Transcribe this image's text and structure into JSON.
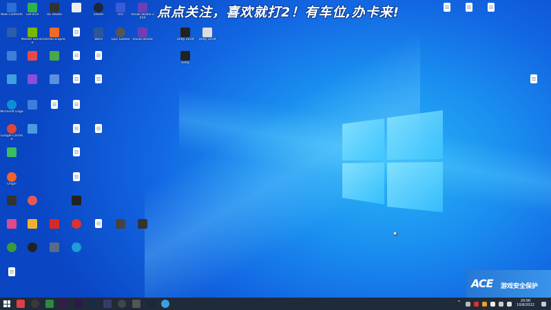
{
  "banner": "点点关注，喜欢就打2！有车位,办卡来!",
  "desktop_icons": [
    {
      "id": "i1",
      "label": "New Contents",
      "color": "#2a6fd1"
    },
    {
      "id": "i2",
      "label": "GeForce",
      "color": "#2eb34a"
    },
    {
      "id": "i3",
      "label": "UE Studio",
      "color": "#333333"
    },
    {
      "id": "i4",
      "label": "",
      "color": "#eeeeee"
    },
    {
      "id": "i5",
      "label": "Steam",
      "color": "#1b2838"
    },
    {
      "id": "i6",
      "label": "Uro",
      "color": "#3a5bd9"
    },
    {
      "id": "i7",
      "label": "Visual Studio 2019",
      "color": "#6c3fb5"
    },
    {
      "id": "i8",
      "label": "",
      "color": "#2b5ea8"
    },
    {
      "id": "i9",
      "label": "NVIDIA GeForce",
      "color": "#76b900"
    },
    {
      "id": "i10",
      "label": "Unreal Engine",
      "color": "#f06a28"
    },
    {
      "id": "i11",
      "label": "",
      "color": "#ffffff"
    },
    {
      "id": "i12",
      "label": "Word",
      "color": "#2b579a"
    },
    {
      "id": "i13",
      "label": "Epic Games",
      "color": "#555555"
    },
    {
      "id": "i14",
      "label": "Visual Studio",
      "color": "#6c3fb5"
    },
    {
      "id": "i15",
      "label": "Unity 2019",
      "color": "#222222"
    },
    {
      "id": "i16",
      "label": "Unity 2019",
      "color": "#dddddd"
    },
    {
      "id": "i17",
      "label": "",
      "color": "#3b80d9"
    },
    {
      "id": "i18",
      "label": "",
      "color": "#e34b4b"
    },
    {
      "id": "i19",
      "label": "",
      "color": "#4aa84a"
    },
    {
      "id": "i20",
      "label": "",
      "color": "#ffffff"
    },
    {
      "id": "i21",
      "label": "",
      "color": "#ffffff"
    },
    {
      "id": "i22",
      "label": "Unity",
      "color": "#222222"
    },
    {
      "id": "i23",
      "label": "",
      "color": "#3fa0e0"
    },
    {
      "id": "i24",
      "label": "",
      "color": "#8a4fd8"
    },
    {
      "id": "i25",
      "label": "",
      "color": "#5b8fe0"
    },
    {
      "id": "i26",
      "label": "",
      "color": "#ffffff"
    },
    {
      "id": "i27",
      "label": "",
      "color": "#ffffff"
    },
    {
      "id": "i28",
      "label": "Microsoft Edge",
      "color": "#0c8fd6"
    },
    {
      "id": "i29",
      "label": "",
      "color": "#3c7fd8"
    },
    {
      "id": "i30",
      "label": "",
      "color": "#ffffff"
    },
    {
      "id": "i31",
      "label": "",
      "color": "#ffffff"
    },
    {
      "id": "i32",
      "label": "Google Chrome",
      "color": "#e0453a"
    },
    {
      "id": "i33",
      "label": "",
      "color": "#4b9be0"
    },
    {
      "id": "i34",
      "label": "",
      "color": "#ffffff"
    },
    {
      "id": "i35",
      "label": "",
      "color": "#ffffff"
    },
    {
      "id": "i36",
      "label": "",
      "color": "#3bbf5c"
    },
    {
      "id": "i37",
      "label": "",
      "color": "#ffffff"
    },
    {
      "id": "i38",
      "label": "Origin",
      "color": "#f0632a"
    },
    {
      "id": "i39",
      "label": "",
      "color": "#ffffff"
    },
    {
      "id": "i40",
      "label": "",
      "color": "#333333"
    },
    {
      "id": "i41",
      "label": "",
      "color": "#e05a5a"
    },
    {
      "id": "i42",
      "label": "",
      "color": "#222222"
    },
    {
      "id": "i43",
      "label": "",
      "color": "#e04a8a"
    },
    {
      "id": "i44",
      "label": "",
      "color": "#f0b030"
    },
    {
      "id": "i45",
      "label": "",
      "color": "#d62828"
    },
    {
      "id": "i46",
      "label": "",
      "color": "#e03030"
    },
    {
      "id": "i47",
      "label": "",
      "color": "#ffffff"
    },
    {
      "id": "i48",
      "label": "",
      "color": "#444444"
    },
    {
      "id": "i49",
      "label": "",
      "color": "#333333"
    },
    {
      "id": "i50",
      "label": "",
      "color": "#3a9a3a"
    },
    {
      "id": "i51",
      "label": "",
      "color": "#222222"
    },
    {
      "id": "i52",
      "label": "",
      "color": "#5a6a8a"
    },
    {
      "id": "i53",
      "label": "",
      "color": "#1f9bd6"
    },
    {
      "id": "i54",
      "label": "",
      "color": "#ffffff"
    },
    {
      "id": "i55",
      "label": "",
      "color": "#ffffff"
    },
    {
      "id": "i56",
      "label": "",
      "color": "#ffffff"
    },
    {
      "id": "i57",
      "label": "",
      "color": "#ffffff"
    },
    {
      "id": "i58",
      "label": "",
      "color": "#ffffff"
    }
  ],
  "ace": {
    "logo": "ACE",
    "text": "游戏安全保护"
  },
  "tray": {
    "time": "20:00",
    "date": "10/8/2022"
  }
}
